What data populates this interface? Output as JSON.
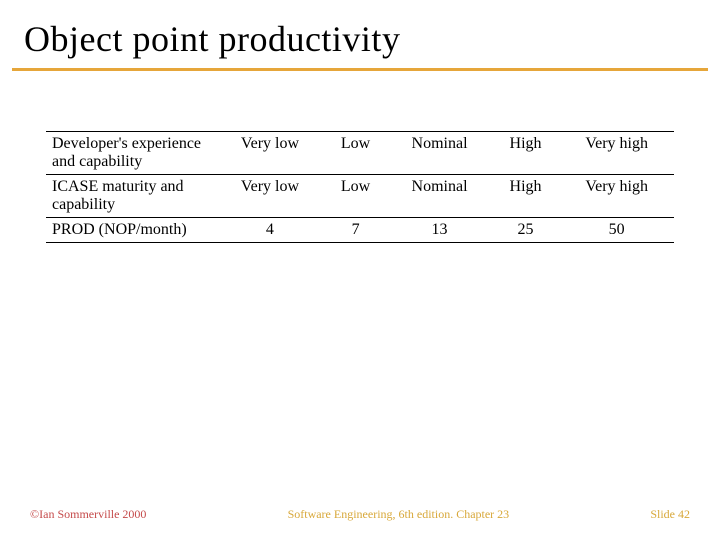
{
  "title": "Object point productivity",
  "table": {
    "rows": [
      {
        "label": "Developer's experience and capability",
        "cells": [
          "Very low",
          "Low",
          "Nominal",
          "High",
          "Very high"
        ]
      },
      {
        "label": "ICASE maturity and capability",
        "cells": [
          "Very low",
          "Low",
          "Nominal",
          "High",
          "Very high"
        ]
      },
      {
        "label": "PROD (NOP/month)",
        "cells": [
          "4",
          "7",
          "13",
          "25",
          "50"
        ]
      }
    ]
  },
  "footer": {
    "left": "©Ian Sommerville 2000",
    "mid": "Software Engineering, 6th edition. Chapter 23",
    "right": "Slide 42"
  }
}
